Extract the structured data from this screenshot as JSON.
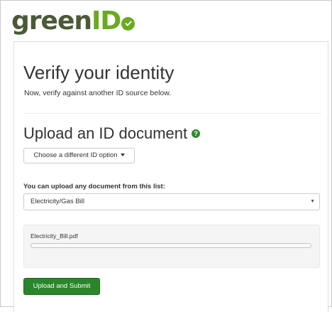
{
  "logo": {
    "text_green": "green",
    "text_id": "ID"
  },
  "page": {
    "title": "Verify your identity",
    "subtitle": "Now, verify against another ID source below."
  },
  "upload_section": {
    "title": "Upload an ID document",
    "help_icon": "question-circle-icon",
    "help_glyph": "?",
    "choose_button_label": "Choose a different ID option",
    "list_label": "You can upload any document from this list:",
    "selected_document": "Electricity/Gas Bill",
    "select_arrow_glyph": "▼",
    "file_name": "Electricity_Bill.pdf",
    "progress": 0,
    "submit_label": "Upload and Submit"
  },
  "colors": {
    "brand_dark": "#4a5a37",
    "brand_green": "#6aaa1f",
    "button_green": "#2a862a"
  }
}
